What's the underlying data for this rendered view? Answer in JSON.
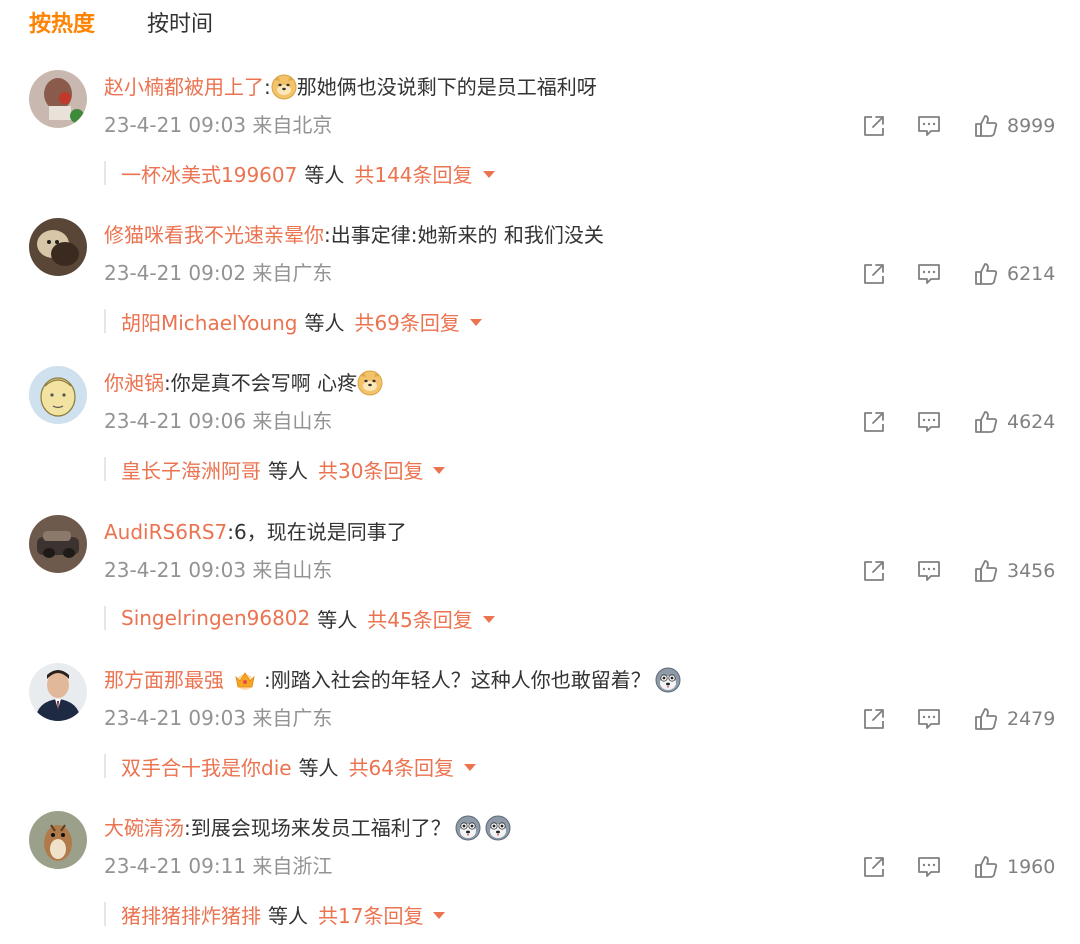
{
  "tabs": {
    "hot": "按热度",
    "time": "按时间"
  },
  "colors": {
    "accent_tab": "#ff8200",
    "username": "#eb7350",
    "meta": "#939393"
  },
  "comments": [
    {
      "user": "赵小楠都被用上了",
      "text_pre": ":",
      "emoji_pre": "doge-emoji",
      "text": "那她俩也没说剩下的是员工福利呀",
      "time": "23-4-21 09:03",
      "loc": "来自北京",
      "likes": "8999",
      "reply_user": "一杯冰美式199607",
      "reply_etc": "等人",
      "reply_total": "共144条回复"
    },
    {
      "user": "修猫咪看我不光速亲晕你",
      "text": ":出事定律:她新来的 和我们没关",
      "time": "23-4-21 09:02",
      "loc": "来自广东",
      "likes": "6214",
      "reply_user": "胡阳MichaelYoung",
      "reply_etc": "等人",
      "reply_total": "共69条回复"
    },
    {
      "user": "你昶锅",
      "text": ":你是真不会写啊 心疼",
      "emoji_post": "doge-emoji",
      "time": "23-4-21 09:06",
      "loc": "来自山东",
      "likes": "4624",
      "reply_user": "皇长子海洲阿哥",
      "reply_etc": "等人",
      "reply_total": "共30条回复"
    },
    {
      "user": "AudiRS6RS7",
      "text": ":6，现在说是同事了",
      "time": "23-4-21 09:03",
      "loc": "来自山东",
      "likes": "3456",
      "reply_user": "Singelringen96802",
      "reply_etc": "等人",
      "reply_total": "共45条回复"
    },
    {
      "user": "那方面那最强",
      "badge": "crown-badge-icon",
      "text": ":刚踏入社会的年轻人？这种人你也敢留着？",
      "emoji_post": "husky-emoji",
      "time": "23-4-21 09:03",
      "loc": "来自广东",
      "likes": "2479",
      "reply_user": "双手合十我是你die",
      "reply_etc": "等人",
      "reply_total": "共64条回复"
    },
    {
      "user": "大碗清汤",
      "text": ":到展会现场来发员工福利了？",
      "emoji_post": "husky-emoji",
      "emoji_post2": "husky-emoji",
      "time": "23-4-21 09:11",
      "loc": "来自浙江",
      "likes": "1960",
      "reply_user": "猪排猪排炸猪排",
      "reply_etc": "等人",
      "reply_total": "共17条回复"
    }
  ]
}
